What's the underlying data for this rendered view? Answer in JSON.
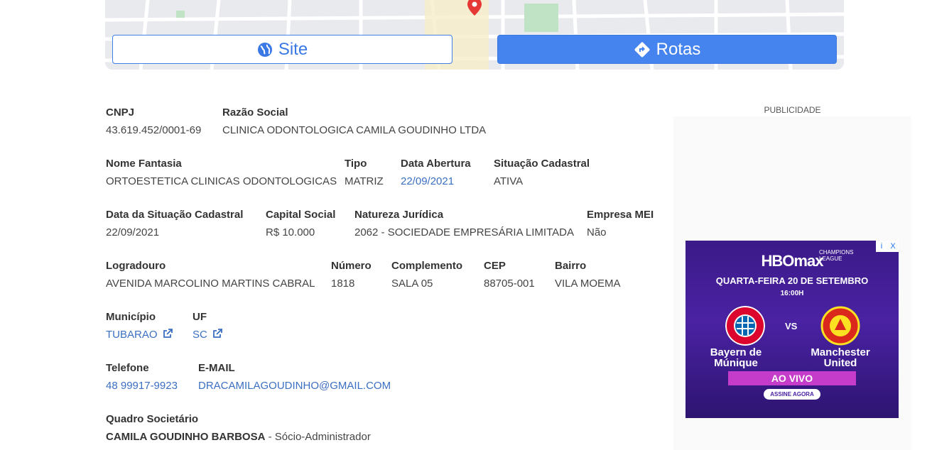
{
  "buttons": {
    "site": "Site",
    "rotas": "Rotas"
  },
  "company": {
    "cnpj": {
      "label": "CNPJ",
      "value": "43.619.452/0001-69"
    },
    "razao": {
      "label": "Razão Social",
      "value": "CLINICA ODONTOLOGICA CAMILA GOUDINHO LTDA"
    },
    "fantasia": {
      "label": "Nome Fantasia",
      "value": "ORTOESTETICA CLINICAS ODONTOLOGICAS"
    },
    "tipo": {
      "label": "Tipo",
      "value": "MATRIZ"
    },
    "abertura": {
      "label": "Data Abertura",
      "value": "22/09/2021"
    },
    "situacao": {
      "label": "Situação Cadastral",
      "value": "ATIVA"
    },
    "data_situacao": {
      "label": "Data da Situação Cadastral",
      "value": "22/09/2021"
    },
    "capital": {
      "label": "Capital Social",
      "value": "R$ 10.000"
    },
    "natureza": {
      "label": "Natureza Jurídica",
      "value": "2062 - SOCIEDADE EMPRESÁRIA LIMITADA"
    },
    "mei": {
      "label": "Empresa MEI",
      "value": "Não"
    },
    "logradouro": {
      "label": "Logradouro",
      "value": "AVENIDA MARCOLINO MARTINS CABRAL"
    },
    "numero": {
      "label": "Número",
      "value": "1818"
    },
    "complemento": {
      "label": "Complemento",
      "value": "SALA 05"
    },
    "cep": {
      "label": "CEP",
      "value": "88705-001"
    },
    "bairro": {
      "label": "Bairro",
      "value": "VILA MOEMA"
    },
    "municipio": {
      "label": "Município",
      "value": "TUBARAO"
    },
    "uf": {
      "label": "UF",
      "value": "SC"
    },
    "telefone": {
      "label": "Telefone",
      "value": "48 99917-9923"
    },
    "email": {
      "label": "E-MAIL",
      "value": "DRACAMILAGOUDINHO@GMAIL.COM"
    },
    "quadro": {
      "label": "Quadro Societário",
      "socio_name": "CAMILA GOUDINHO BARBOSA",
      "socio_role": " - Sócio-Administrador"
    }
  },
  "ad": {
    "section_label": "PUBLICIDADE",
    "brand": "HBOmax",
    "league": "CHAMPIONS LEAGUE",
    "date": "QUARTA-FEIRA 20 DE SETEMBRO",
    "time": "16:00H",
    "team1": "Bayern de Múnique",
    "team2": "Manchester United",
    "vs": "VS",
    "live": "AO VIVO",
    "cta": "ASSINE AGORA",
    "info": "i",
    "close": "X",
    "crest1_text": "FC BAYERN MÜNCHEN",
    "crest2_text": "MANCHESTER UNITED"
  },
  "colors": {
    "accent": "#4584ee",
    "link": "#3b6fc2",
    "ad_purple": "#4a22a3"
  }
}
